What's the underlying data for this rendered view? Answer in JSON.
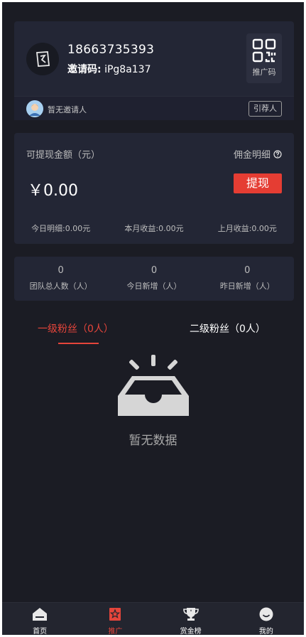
{
  "profile": {
    "phone": "18663735393",
    "invite_label": "邀请码:",
    "invite_code": "iPg8a137",
    "qr_label": "推广码",
    "referrer_text": "暂无邀请人",
    "referrer_button": "引荐人"
  },
  "balance": {
    "title": "可提现金额（元）",
    "commission_detail": "佣金明细",
    "amount": "￥0.00",
    "withdraw_label": "提现",
    "stats": [
      "今日明细:0.00元",
      "本月收益:0.00元",
      "上月收益:0.00元"
    ]
  },
  "team": [
    {
      "value": "0",
      "label": "团队总人数（人）"
    },
    {
      "value": "0",
      "label": "今日新增（人）"
    },
    {
      "value": "0",
      "label": "昨日新增（人）"
    }
  ],
  "tabs": [
    {
      "label": "一级粉丝（0人）"
    },
    {
      "label": "二级粉丝（0人）"
    }
  ],
  "empty": {
    "text": "暂无数据"
  },
  "tabbar": [
    {
      "label": "首页",
      "icon": "home-icon"
    },
    {
      "label": "推广",
      "icon": "promote-icon"
    },
    {
      "label": "赏金榜",
      "icon": "trophy-icon"
    },
    {
      "label": "我的",
      "icon": "profile-icon"
    }
  ],
  "colors": {
    "accent": "#e53d33",
    "background": "#1b1c24",
    "card": "#232635"
  }
}
